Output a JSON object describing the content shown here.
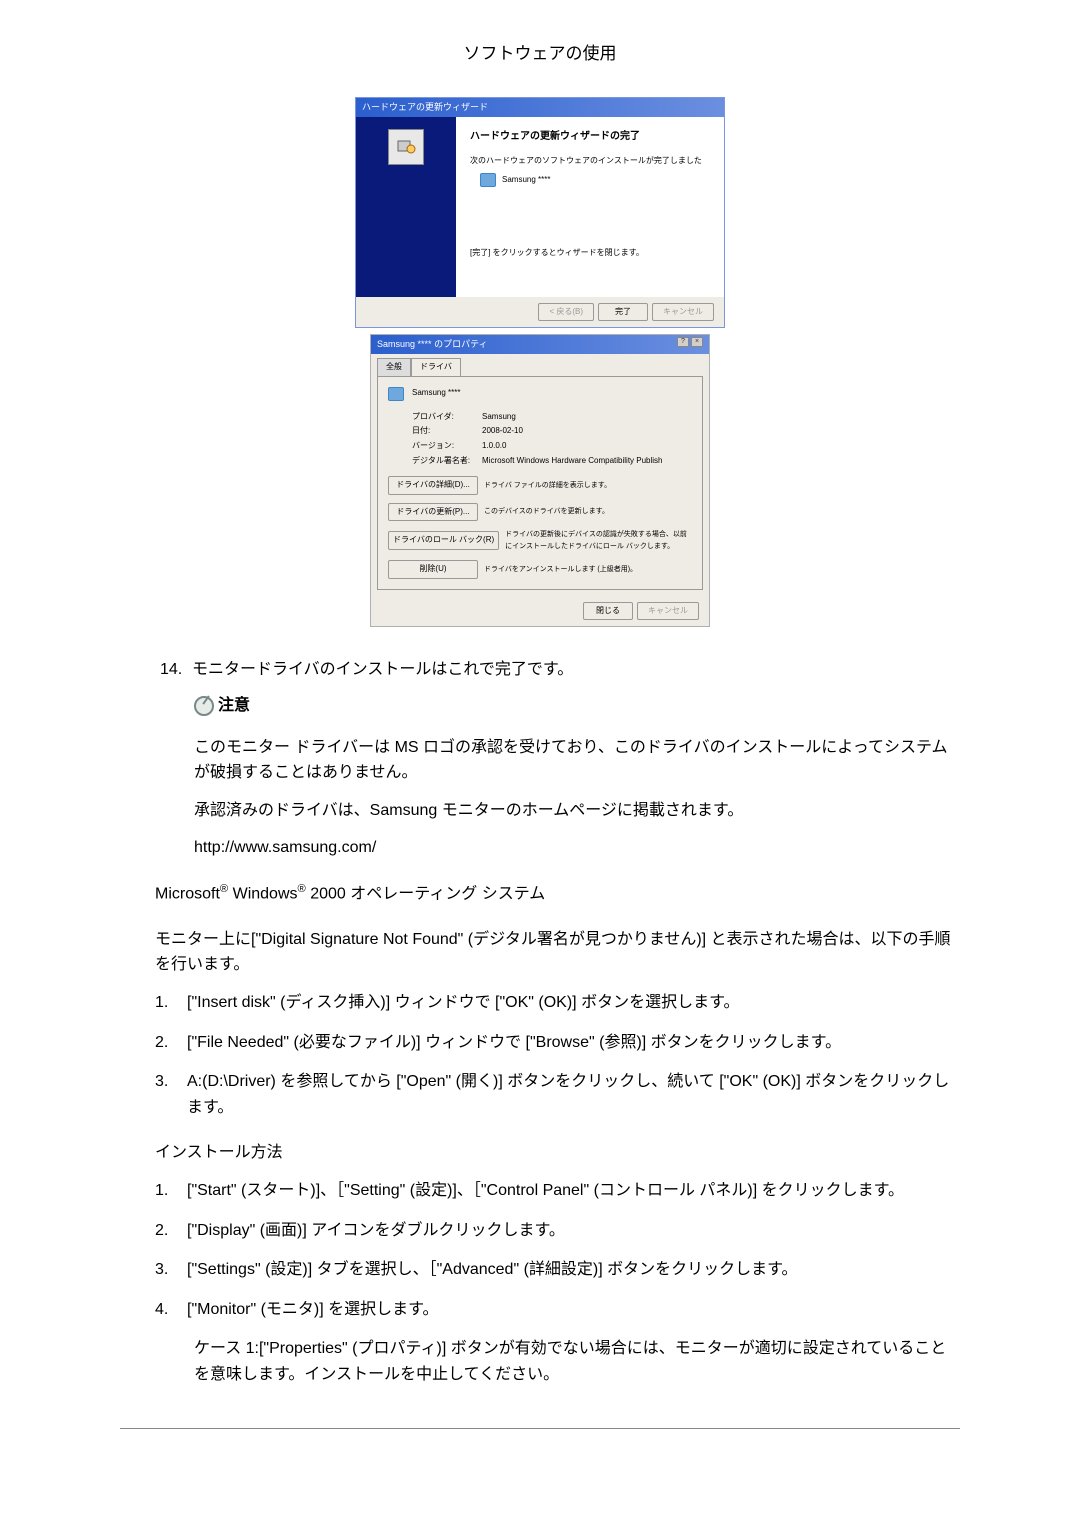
{
  "header": "ソフトウェアの使用",
  "wizard": {
    "titlebar": "ハードウェアの更新ウィザード",
    "heading": "ハードウェアの更新ウィザードの完了",
    "subtitle": "次のハードウェアのソフトウェアのインストールが完了しました",
    "device_name": "Samsung ****",
    "close_text": "[完了] をクリックするとウィザードを閉じます。",
    "btn_back": "< 戻る(B)",
    "btn_finish": "完了",
    "btn_cancel": "キャンセル"
  },
  "props": {
    "title_prefix": "Samsung",
    "title_mid": "****",
    "title_suffix": "のプロパティ",
    "tab_general": "全般",
    "tab_driver": "ドライバ",
    "device_name": "Samsung ****",
    "rows": {
      "provider_label": "プロバイダ:",
      "provider_value": "Samsung",
      "date_label": "日付:",
      "date_value": "2008-02-10",
      "version_label": "バージョン:",
      "version_value": "1.0.0.0",
      "signer_label": "デジタル署名者:",
      "signer_value": "Microsoft Windows Hardware Compatibility Publish"
    },
    "btn_detail": "ドライバの詳細(D)...",
    "desc_detail": "ドライバ ファイルの詳細を表示します。",
    "btn_update": "ドライバの更新(P)...",
    "desc_update": "このデバイスのドライバを更新します。",
    "btn_rollback": "ドライバのロール バック(R)",
    "desc_rollback": "ドライバの更新後にデバイスの認識が失敗する場合、以前にインストールしたドライバにロール バックします。",
    "btn_uninstall": "削除(U)",
    "desc_uninstall": "ドライバをアンインストールします (上級者用)。",
    "btn_close": "閉じる",
    "btn_cancel": "キャンセル"
  },
  "step14": {
    "num": "14.",
    "text": "モニタードライバのインストールはこれで完了です。"
  },
  "note_label": "注意",
  "note_para1": "このモニター ドライバーは MS ロゴの承認を受けており、このドライバのインストールによってシステムが破損することはありません。",
  "note_para2": "承認済みのドライバは、Samsung モニターのホームページに掲載されます。",
  "url": "http://www.samsung.com/",
  "os_line_pre": "Microsoft",
  "os_line_mid": " Windows",
  "os_line_post": " 2000 オペレーティング システム",
  "sig_notfound": "モニター上に[\"Digital Signature Not Found\" (デジタル署名が見つかりません)] と表示された場合は、以下の手順を行います。",
  "list1": [
    {
      "n": "1.",
      "t": "[\"Insert disk\" (ディスク挿入)] ウィンドウで [\"OK\" (OK)] ボタンを選択します。"
    },
    {
      "n": "2.",
      "t": "[\"File Needed\" (必要なファイル)] ウィンドウで [\"Browse\" (参照)] ボタンをクリックします。"
    },
    {
      "n": "3.",
      "t": "A:(D:\\Driver) を参照してから [\"Open\" (開く)] ボタンをクリックし、続いて [\"OK\" (OK)] ボタンをクリックします。"
    }
  ],
  "install_method": "インストール方法",
  "list2": [
    {
      "n": "1.",
      "t": "[\"Start\" (スタート)]、［\"Setting\" (設定)]、［\"Control Panel\" (コントロール パネル)] をクリックします。"
    },
    {
      "n": "2.",
      "t": "[\"Display\" (画面)] アイコンをダブルクリックします。"
    },
    {
      "n": "3.",
      "t": "[\"Settings\" (設定)] タブを選択し、［\"Advanced\" (詳細設定)] ボタンをクリックします。"
    },
    {
      "n": "4.",
      "t": "[\"Monitor\" (モニタ)] を選択します。"
    }
  ],
  "case1": "ケース 1:[\"Properties\" (プロパティ)] ボタンが有効でない場合には、モニターが適切に設定されていることを意味します。インストールを中止してください。"
}
